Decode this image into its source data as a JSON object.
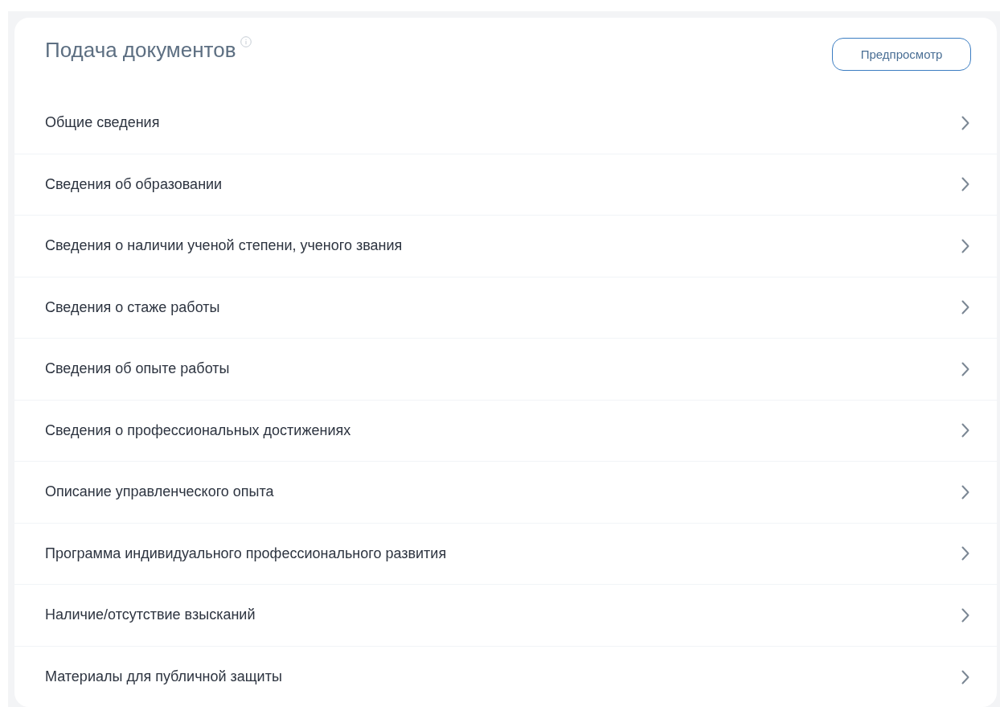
{
  "header": {
    "title": "Подача документов",
    "preview_button": "Предпросмотр"
  },
  "sections": [
    {
      "label": "Общие сведения"
    },
    {
      "label": "Сведения об образовании"
    },
    {
      "label": "Сведения о наличии ученой степени, ученого звания"
    },
    {
      "label": "Сведения о стаже работы"
    },
    {
      "label": "Сведения об опыте работы"
    },
    {
      "label": "Сведения о профессиональных достижениях"
    },
    {
      "label": "Описание управленческого опыта"
    },
    {
      "label": "Программа индивидуального профессионального развития"
    },
    {
      "label": "Наличие/отсутствие взысканий"
    },
    {
      "label": "Материалы для публичной защиты"
    }
  ]
}
